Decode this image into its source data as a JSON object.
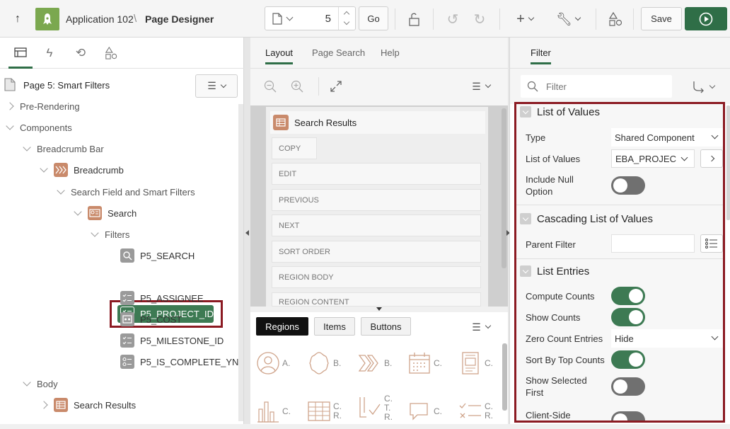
{
  "header": {
    "app_name": "Application 102",
    "separator": "\\",
    "page_designer": "Page Designer",
    "page_number": "5",
    "go_label": "Go",
    "save_label": "Save"
  },
  "left": {
    "page_title": "Page 5: Smart Filters",
    "tree": [
      {
        "label": "Pre-Rendering"
      },
      {
        "label": "Components"
      },
      {
        "label": "Breadcrumb Bar"
      },
      {
        "label": "Breadcrumb"
      },
      {
        "label": "Search Field and Smart Filters"
      },
      {
        "label": "Search"
      },
      {
        "label": "Filters"
      },
      {
        "label": "P5_SEARCH"
      },
      {
        "label": "P5_PROJECT_ID"
      },
      {
        "label": "P5_ASSIGNEE"
      },
      {
        "label": "P5_COST"
      },
      {
        "label": "P5_MILESTONE_ID"
      },
      {
        "label": "P5_IS_COMPLETE_YN"
      },
      {
        "label": "Body"
      },
      {
        "label": "Search Results"
      }
    ]
  },
  "middle": {
    "tabs": [
      "Layout",
      "Page Search",
      "Help"
    ],
    "region_title": "Search Results",
    "positions": [
      "COPY",
      "EDIT",
      "PREVIOUS",
      "NEXT",
      "SORT ORDER",
      "REGION BODY",
      "REGION CONTENT"
    ],
    "gallery_tabs": [
      "Regions",
      "Items",
      "Buttons"
    ],
    "gallery": [
      {
        "label": "A."
      },
      {
        "label": "B."
      },
      {
        "label": "B."
      },
      {
        "label": "C."
      },
      {
        "label": "C."
      },
      {
        "label": "C."
      },
      {
        "label": "C.\nR."
      },
      {
        "label": "C.\nT.\nR."
      },
      {
        "label": "C."
      },
      {
        "label": "C.\nR."
      }
    ]
  },
  "right": {
    "tab": "Filter",
    "filter_placeholder": "Filter",
    "sections": {
      "lov": "List of Values",
      "cascading": "Cascading List of Values",
      "entries": "List Entries"
    },
    "props": {
      "type_label": "Type",
      "type_value": "Shared Component",
      "lov_label": "List of Values",
      "lov_value": "EBA_PROJECT",
      "include_null_label": "Include Null\nOption",
      "parent_filter_label": "Parent Filter",
      "compute_counts_label": "Compute Counts",
      "show_counts_label": "Show Counts",
      "zero_count_label": "Zero Count Entries",
      "zero_count_value": "Hide",
      "sort_top_label": "Sort By Top Counts",
      "show_selected_label": "Show Selected\nFirst",
      "client_side_label": "Client-Side"
    },
    "toggles": {
      "include_null": false,
      "compute_counts": true,
      "show_counts": true,
      "sort_top": true,
      "show_selected": false,
      "client_side": false
    }
  },
  "colors": {
    "accent_green": "#2f6e47",
    "highlight_red": "#8b1a22",
    "region_icon": "#c98a6b"
  }
}
